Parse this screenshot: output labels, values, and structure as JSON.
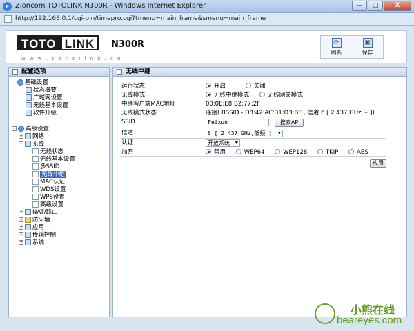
{
  "window": {
    "title": "Zioncom TOTOLINK N300R - Windows Internet Explorer",
    "minimize": "—",
    "maximize": "□",
    "close": "X",
    "url": "http://192.168.0.1/cgi-bin/timepro.cgi?tmenu=main_frame&smenu=main_frame"
  },
  "banner": {
    "logo_part1": "TOTO",
    "logo_part2": "LINK",
    "model": "N300R",
    "tagline": "w w w . t o t o l i n k . c n",
    "refresh_label": "刷新",
    "save_label": "保存"
  },
  "sidebar": {
    "title": "配置选项",
    "items": {
      "basic": "基础设置",
      "status": "状态概要",
      "wan": "广域网设置",
      "wireless_basic": "无线基本设置",
      "upgrade": "软件升级",
      "advanced": "高级设置",
      "network": "网络",
      "wireless": "无线",
      "wl_status": "无线状态",
      "wl_basic": "无线基本设置",
      "multi_ssid": "多SSID",
      "wl_repeater": "无线中继",
      "mac_auth": "MAC认证",
      "wds": "WDS设置",
      "wps": "WPS设置",
      "wl_advanced": "高级设置",
      "nat": "NAT/路由",
      "firewall": "防火墙",
      "app": "应用",
      "traffic": "传输控制",
      "system": "系统"
    }
  },
  "content": {
    "title": "无线中继",
    "rows": {
      "run_status": {
        "label": "运行状态",
        "on": "开启",
        "off": "关闭"
      },
      "wl_mode": {
        "label": "无线模式",
        "opt1": "无线中继模式",
        "opt2": "无线网关模式"
      },
      "client_mac": {
        "label": "中继客户端MAC地址",
        "value": "00:0E:E8:B2:77:2F"
      },
      "mode_status": {
        "label": "无线模式状态",
        "value": "连接( BSSID - D8:42:AC:31:D3:BF , 信道  6 [ 2.437 GHz ~ ])"
      },
      "ssid": {
        "label": "SSID",
        "value": "Feixun",
        "search_button": "搜索AP"
      },
      "channel": {
        "label": "信道",
        "value": "6  [ 2.437 GHz,低频 ]"
      },
      "auth": {
        "label": "认证",
        "value": "开放系统"
      },
      "encrypt": {
        "label": "加密",
        "opt_disable": "禁用",
        "opt_wep64": "WEP64",
        "opt_wep128": "WEP128",
        "opt_tkip": "TKIP",
        "opt_aes": "AES"
      }
    },
    "apply_button": "应用"
  },
  "watermark": {
    "cn": "小熊在线",
    "en": "beareyes.com"
  }
}
